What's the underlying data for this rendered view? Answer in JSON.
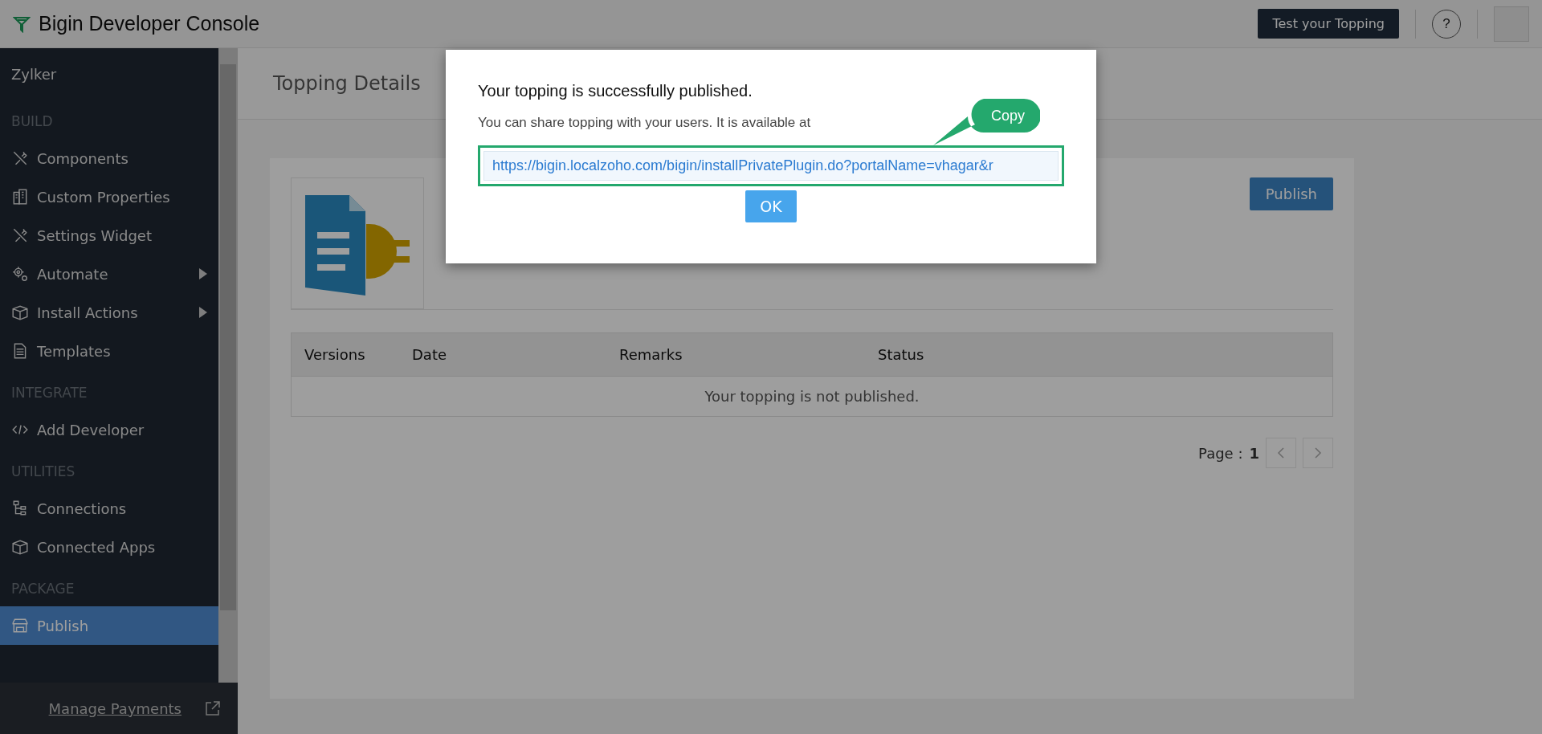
{
  "topbar": {
    "title": "Bigin Developer Console",
    "test_button": "Test your Topping",
    "help": "?"
  },
  "sidebar": {
    "org": "Zylker",
    "items": [
      {
        "kind": "header",
        "label": "BUILD"
      },
      {
        "kind": "item",
        "label": "Components",
        "submenu": false,
        "selected": false
      },
      {
        "kind": "item",
        "label": "Custom Properties",
        "submenu": false,
        "selected": false
      },
      {
        "kind": "item",
        "label": "Settings Widget",
        "submenu": false,
        "selected": false
      },
      {
        "kind": "item",
        "label": "Automate",
        "submenu": true,
        "selected": false
      },
      {
        "kind": "item",
        "label": "Install Actions",
        "submenu": true,
        "selected": false
      },
      {
        "kind": "item",
        "label": "Templates",
        "submenu": false,
        "selected": false
      },
      {
        "kind": "header",
        "label": "INTEGRATE"
      },
      {
        "kind": "item",
        "label": "Add Developer",
        "submenu": false,
        "selected": false
      },
      {
        "kind": "header",
        "label": "UTILITIES"
      },
      {
        "kind": "item",
        "label": "Connections",
        "submenu": false,
        "selected": false
      },
      {
        "kind": "item",
        "label": "Connected Apps",
        "submenu": false,
        "selected": false
      },
      {
        "kind": "header",
        "label": "PACKAGE"
      },
      {
        "kind": "item",
        "label": "Publish",
        "submenu": false,
        "selected": true
      }
    ],
    "footer_link": "Manage Payments"
  },
  "page": {
    "title": "Topping Details",
    "publish_button": "Publish",
    "table": {
      "columns": [
        "Versions",
        "Date",
        "Remarks",
        "Status"
      ],
      "empty_message": "Your topping is not published."
    },
    "pager": {
      "label": "Page :",
      "page": "1"
    }
  },
  "dialog": {
    "title": "Your topping is successfully published.",
    "message": "You can share topping with your users. It is available at",
    "url": "https://bigin.localzoho.com/bigin/installPrivatePlugin.do?portalName=vhagar&r",
    "callout": "Copy",
    "ok_button": "OK"
  }
}
